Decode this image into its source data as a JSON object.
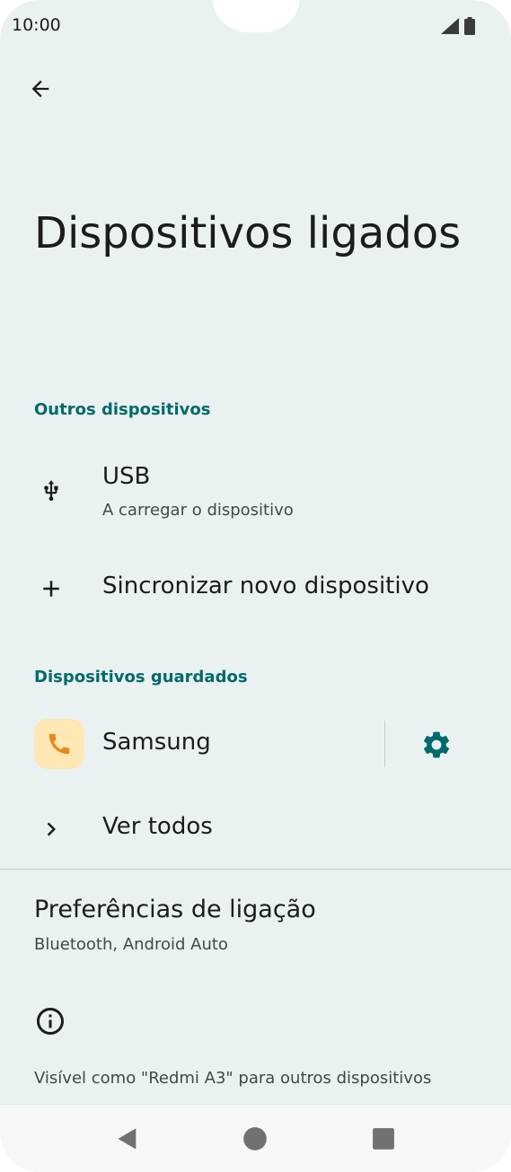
{
  "status_bar": {
    "time": "10:00"
  },
  "header": {
    "title": "Dispositivos ligados"
  },
  "sections": {
    "other_devices": {
      "header": "Outros dispositivos",
      "usb": {
        "title": "USB",
        "subtitle": "A carregar o dispositivo",
        "icon": "usb-icon"
      },
      "pair_new": {
        "title": "Sincronizar novo dispositivo",
        "icon": "plus-icon"
      }
    },
    "saved_devices": {
      "header": "Dispositivos guardados",
      "samsung": {
        "title": "Samsung",
        "icon": "phone-icon",
        "settings_icon": "gear-icon"
      },
      "see_all": {
        "title": "Ver todos",
        "icon": "chevron-right-icon"
      }
    }
  },
  "preferences": {
    "title": "Preferências de ligação",
    "subtitle": "Bluetooth, Android Auto"
  },
  "footer": {
    "icon": "info-icon",
    "visible_as": "Visível como \"Redmi A3\" para outros dispositivos"
  },
  "colors": {
    "background": "#eaf2f1",
    "accent": "#006a6a",
    "text_primary": "#1b1c1c",
    "text_secondary": "#3f4948",
    "phone_icon_bg": "#ffe7b6",
    "phone_icon_fg": "#e8891c"
  }
}
